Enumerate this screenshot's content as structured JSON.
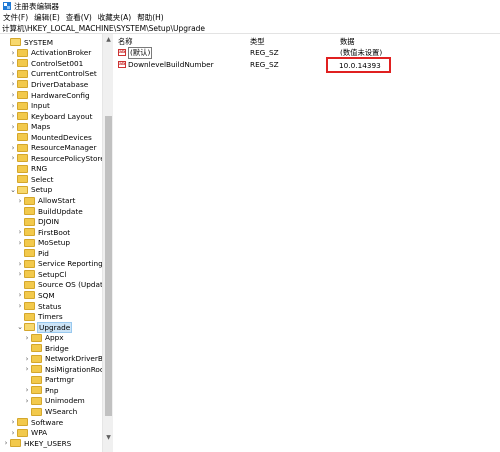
{
  "window": {
    "title": "注册表编辑器"
  },
  "menu": [
    "文件(F)",
    "编辑(E)",
    "查看(V)",
    "收藏夹(A)",
    "帮助(H)"
  ],
  "address": "计算机\\HKEY_LOCAL_MACHINE\\SYSTEM\\Setup\\Upgrade",
  "tree": [
    {
      "label": "SYSTEM",
      "expander": "",
      "open": true
    },
    {
      "label": "ActivationBroker",
      "expander": ">"
    },
    {
      "label": "ControlSet001",
      "expander": ">"
    },
    {
      "label": "CurrentControlSet",
      "expander": ">"
    },
    {
      "label": "DriverDatabase",
      "expander": ">"
    },
    {
      "label": "HardwareConfig",
      "expander": ">"
    },
    {
      "label": "Input",
      "expander": ">"
    },
    {
      "label": "Keyboard Layout",
      "expander": ">"
    },
    {
      "label": "Maps",
      "expander": ">"
    },
    {
      "label": "MountedDevices",
      "expander": ""
    },
    {
      "label": "ResourceManager",
      "expander": ">"
    },
    {
      "label": "ResourcePolicyStore",
      "expander": ">"
    },
    {
      "label": "RNG",
      "expander": ""
    },
    {
      "label": "Select",
      "expander": ""
    },
    {
      "label": "Setup",
      "expander": "v",
      "open": true
    },
    {
      "label": "AllowStart",
      "expander": ">"
    },
    {
      "label": "BuildUpdate",
      "expander": ""
    },
    {
      "label": "DJOIN",
      "expander": ""
    },
    {
      "label": "FirstBoot",
      "expander": ">"
    },
    {
      "label": "MoSetup",
      "expander": ">"
    },
    {
      "label": "Pid",
      "expander": ""
    },
    {
      "label": "Service Reporting API",
      "expander": ">"
    },
    {
      "label": "SetupCl",
      "expander": ">"
    },
    {
      "label": "Source OS (Updated on",
      "expander": ""
    },
    {
      "label": "SQM",
      "expander": ">"
    },
    {
      "label": "Status",
      "expander": ">"
    },
    {
      "label": "Timers",
      "expander": ""
    },
    {
      "label": "Upgrade",
      "expander": "v",
      "open": true,
      "selected": true
    },
    {
      "label": "Appx",
      "expander": ">"
    },
    {
      "label": "Bridge",
      "expander": ""
    },
    {
      "label": "NetworkDriverBackup",
      "expander": ">"
    },
    {
      "label": "NsiMigrationRoot",
      "expander": ">"
    },
    {
      "label": "Partmgr",
      "expander": ""
    },
    {
      "label": "Pnp",
      "expander": ">"
    },
    {
      "label": "Unimodem",
      "expander": ">"
    },
    {
      "label": "WSearch",
      "expander": ""
    },
    {
      "label": "Software",
      "expander": ">"
    },
    {
      "label": "WPA",
      "expander": ">"
    },
    {
      "label": "HKEY_USERS",
      "expander": ">"
    }
  ],
  "columns": {
    "name": "名称",
    "type": "类型",
    "data": "数据"
  },
  "values": [
    {
      "name": "(默认)",
      "type": "REG_SZ",
      "data": "(数值未设置)"
    },
    {
      "name": "DownlevelBuildNumber",
      "type": "REG_SZ",
      "data": "10.0.14393"
    }
  ],
  "icons": {
    "value_icon": "string-value-icon",
    "folder_icon": "folder-icon"
  },
  "colors": {
    "highlight_border": "#e02020",
    "selection": "#cce4f7",
    "folder": "#f2c94c"
  }
}
